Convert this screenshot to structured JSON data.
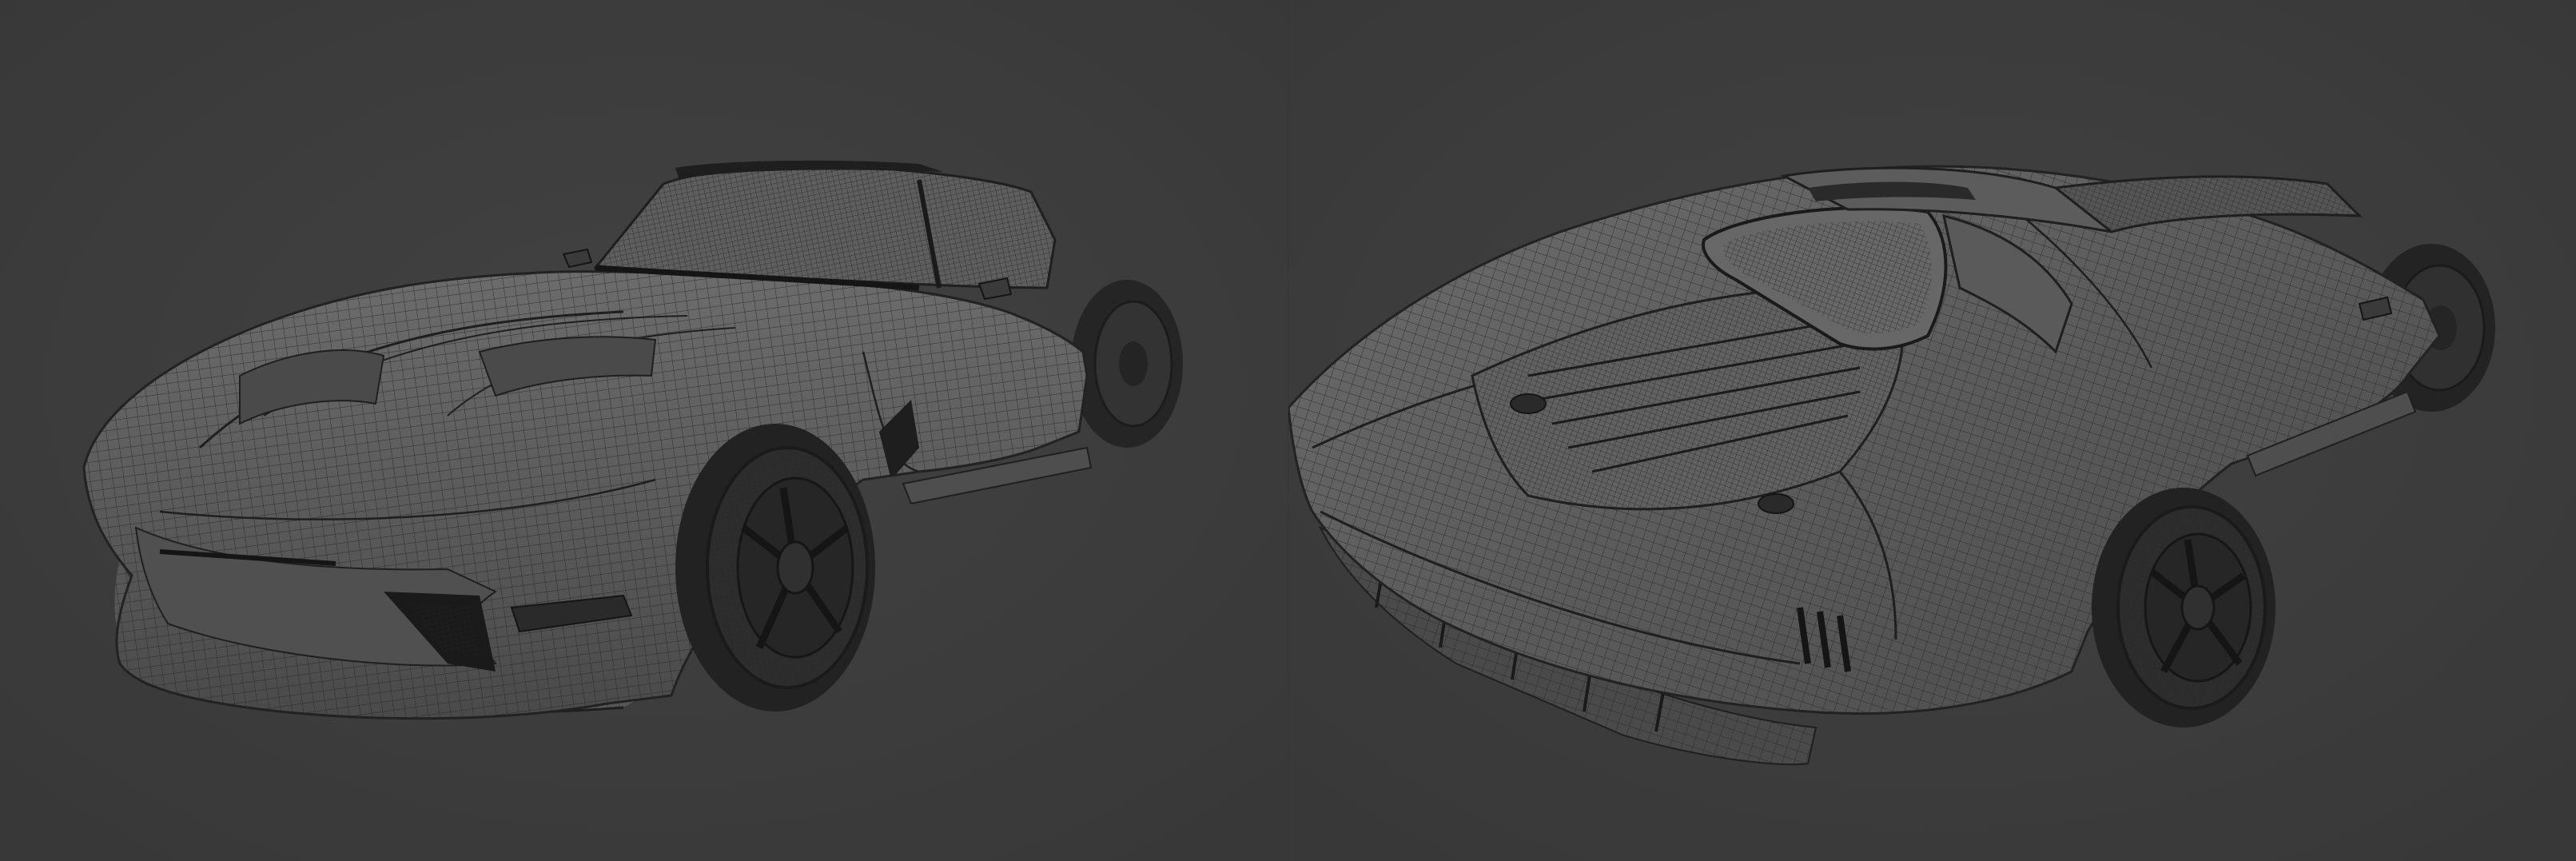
{
  "colors": {
    "viewport_bg": "#3c3c3c",
    "viewport_bg_vignette": "#353535",
    "body_fill": "#5a5a5a",
    "body_highlight": "#6a6a6a",
    "body_shadow": "#4a4a4a",
    "wire_line": "#242424",
    "wire_line_faint": "#333333",
    "dark_parts": "#1e1e1e",
    "tire": "#262626",
    "rim": "#3a3a3a"
  },
  "views": [
    {
      "id": "front-three-quarter",
      "icon": "wireframe-car-front-icon"
    },
    {
      "id": "rear-three-quarter",
      "icon": "wireframe-car-rear-icon"
    }
  ]
}
